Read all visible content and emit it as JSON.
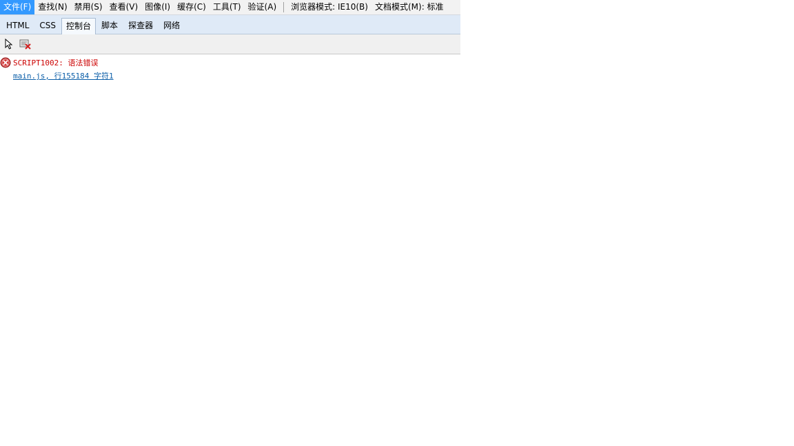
{
  "menubar": {
    "items": [
      {
        "label": "文件(F)",
        "active": true
      },
      {
        "label": "查找(N)"
      },
      {
        "label": "禁用(S)"
      },
      {
        "label": "查看(V)"
      },
      {
        "label": "图像(I)"
      },
      {
        "label": "缓存(C)"
      },
      {
        "label": "工具(T)"
      },
      {
        "label": "验证(A)"
      }
    ],
    "browser_mode": "浏览器模式: IE10(B)",
    "document_mode": "文档模式(M): 标准"
  },
  "tabs": [
    {
      "label": "HTML"
    },
    {
      "label": "CSS"
    },
    {
      "label": "控制台",
      "active": true
    },
    {
      "label": "脚本"
    },
    {
      "label": "探查器"
    },
    {
      "label": "网络"
    }
  ],
  "toolbar": {
    "icons": [
      "select-element-icon",
      "clear-console-icon"
    ]
  },
  "console": {
    "messages": [
      {
        "type": "error",
        "icon": "error-icon",
        "text": "SCRIPT1002: 语法错误",
        "source": "main.js, 行155184 字符1"
      }
    ]
  },
  "colors": {
    "menu_active": "#3399ff",
    "tabbar_bg": "#dfeaf7",
    "error_text": "#cc0000",
    "link": "#0b5ea8"
  }
}
